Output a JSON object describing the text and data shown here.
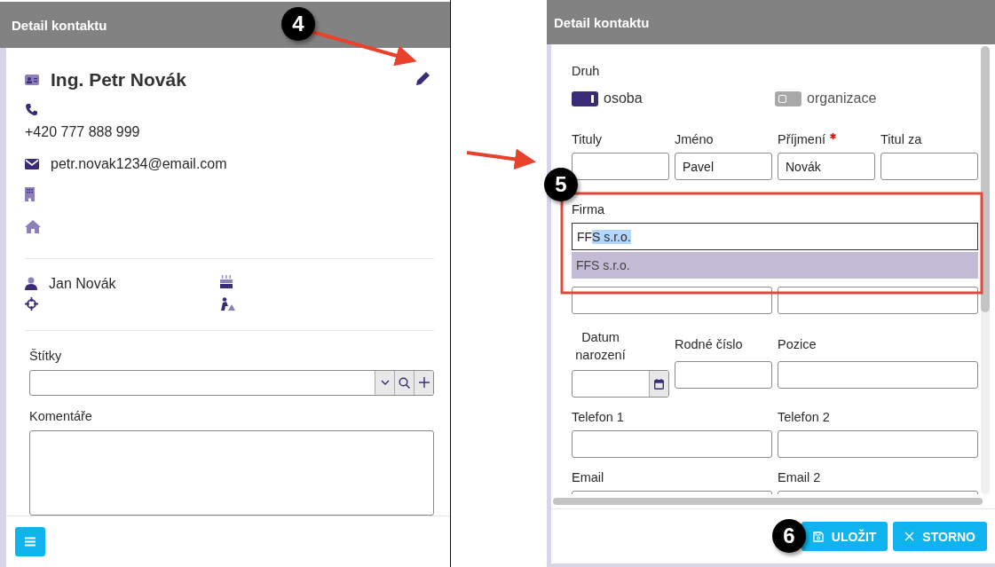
{
  "detail_panel": {
    "title": "Detail kontaktu",
    "name": "Ing. Petr Novák",
    "phone": "+420 777 888 999",
    "email": "petr.novak1234@email.com",
    "contact_person": "Jan Novák",
    "tags": {
      "label": "Štítky"
    },
    "comments": {
      "label": "Komentáře"
    }
  },
  "edit_panel": {
    "title": "Detail kontaktu",
    "type_label": "Druh",
    "types": [
      {
        "label": "osoba",
        "on": true
      },
      {
        "label": "organizace",
        "on": false
      }
    ],
    "name_fields": [
      {
        "label": "Tituly",
        "required": false
      },
      {
        "label": "Jméno",
        "value": "Pavel",
        "required": false
      },
      {
        "label": "Příjmení",
        "value": "Novák",
        "required": true
      },
      {
        "label": "Titul za",
        "required": false
      }
    ],
    "company": {
      "label": "Firma",
      "typed": "FF",
      "selected_text": "S s.r.o.",
      "suggestion": "FFS s.r.o."
    },
    "birth_date": {
      "label": "Datum narození"
    },
    "other_fields": [
      {
        "label": "Rodné číslo"
      },
      {
        "label": "Pozice"
      },
      {
        "label": "Telefon 1"
      },
      {
        "label": "Telefon 2"
      },
      {
        "label": "Email"
      },
      {
        "label": "Email 2"
      }
    ],
    "buttons": [
      {
        "kind": "save",
        "label": "ULOŽIT"
      },
      {
        "kind": "cancel",
        "label": "STORNO"
      }
    ]
  },
  "callouts": [
    "4",
    "5",
    "6"
  ]
}
